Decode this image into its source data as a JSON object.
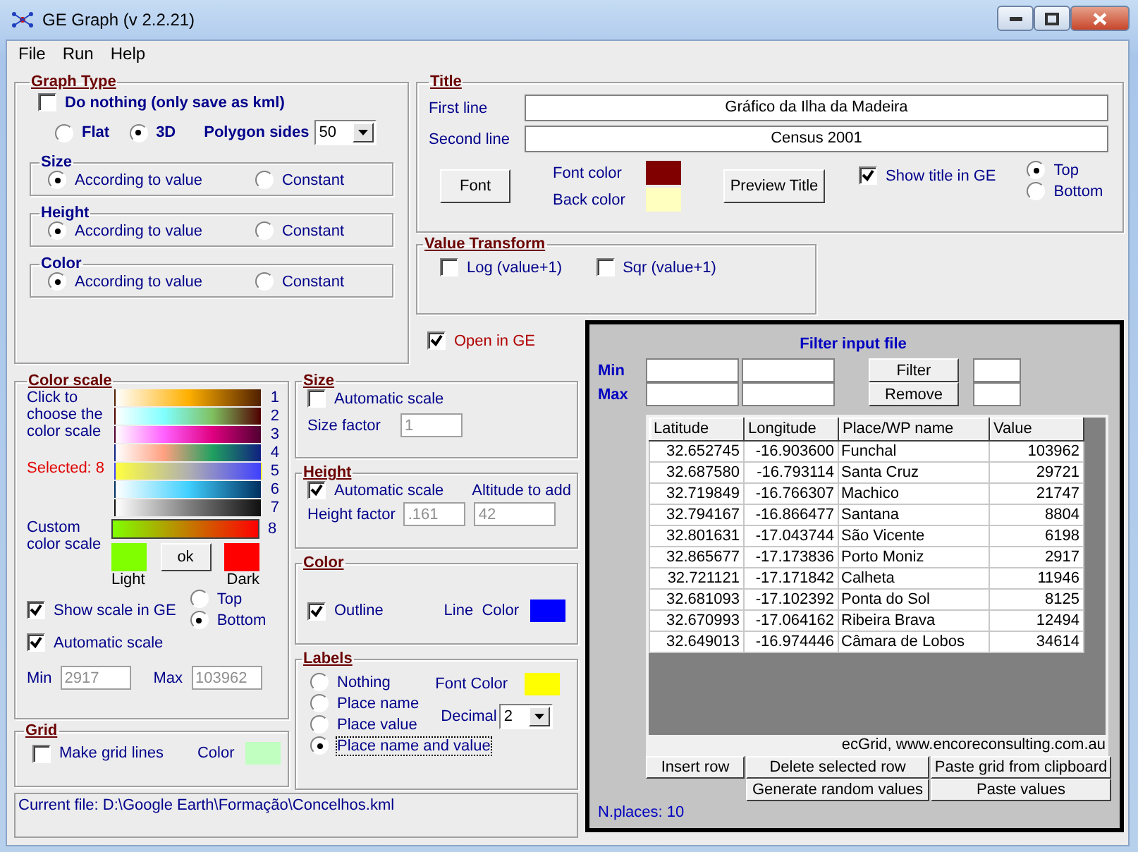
{
  "window": {
    "title": "GE Graph (v 2.2.21)"
  },
  "menu": [
    "File",
    "Run",
    "Help"
  ],
  "graph_type": {
    "title": "Graph Type",
    "do_nothing": {
      "label": "Do nothing (only save as kml)",
      "checked": false
    },
    "modes": [
      {
        "label": "Flat",
        "selected": false
      },
      {
        "label": "3D",
        "selected": true
      }
    ],
    "polygon_sides": {
      "label": "Polygon sides",
      "value": "50"
    },
    "subgroups": [
      {
        "title": "Size",
        "options": [
          {
            "label": "According to value",
            "selected": true
          },
          {
            "label": "Constant",
            "selected": false
          }
        ]
      },
      {
        "title": "Height",
        "options": [
          {
            "label": "According to value",
            "selected": true
          },
          {
            "label": "Constant",
            "selected": false
          }
        ]
      },
      {
        "title": "Color",
        "options": [
          {
            "label": "According to value",
            "selected": true
          },
          {
            "label": "Constant",
            "selected": false
          }
        ]
      }
    ]
  },
  "title_group": {
    "title": "Title",
    "lines": [
      {
        "label": "First line",
        "value": "Gráfico da Ilha da Madeira"
      },
      {
        "label": "Second line",
        "value": "Census 2001"
      }
    ],
    "font_button": "Font",
    "colors": [
      {
        "label": "Font color",
        "color": "#800000"
      },
      {
        "label": "Back color",
        "color": "#ffffc0"
      }
    ],
    "preview_button": "Preview Title",
    "show_title": {
      "label": "Show title in GE",
      "checked": true
    },
    "positions": [
      {
        "label": "Top",
        "selected": true
      },
      {
        "label": "Bottom",
        "selected": false
      }
    ]
  },
  "value_transform": {
    "title": "Value Transform",
    "options": [
      {
        "label": "Log (value+1)",
        "checked": false
      },
      {
        "label": "Sqr (value+1)",
        "checked": false
      }
    ]
  },
  "open_in_ge": {
    "label": "Open in GE",
    "checked": true
  },
  "color_scale": {
    "title": "Color scale",
    "hint": "Click to choose the color scale",
    "selected_text": "Selected: 8",
    "scales": [
      {
        "number": "1"
      },
      {
        "number": "2"
      },
      {
        "number": "3"
      },
      {
        "number": "4"
      },
      {
        "number": "5"
      },
      {
        "number": "6"
      },
      {
        "number": "7"
      }
    ],
    "custom_label": "Custom color scale",
    "custom_scale": {
      "number": "8"
    },
    "light": {
      "label": "Light",
      "color": "#80ff00"
    },
    "ok_button": "ok",
    "dark": {
      "label": "Dark",
      "color": "#ff0000"
    },
    "show_scale": {
      "label": "Show scale in GE",
      "checked": true
    },
    "positions": [
      {
        "label": "Top",
        "selected": false
      },
      {
        "label": "Bottom",
        "selected": true
      }
    ],
    "automatic_scale": {
      "label": "Automatic scale",
      "checked": true
    },
    "min": {
      "label": "Min",
      "value": "2917",
      "disabled": true
    },
    "max": {
      "label": "Max",
      "value": "103962",
      "disabled": true
    }
  },
  "grid": {
    "title": "Grid",
    "make_lines": {
      "label": "Make grid lines",
      "checked": false
    },
    "line_color": {
      "label": "Color",
      "color": "#c0ffc0"
    }
  },
  "size": {
    "title": "Size",
    "automatic_scale": {
      "label": "Automatic scale",
      "checked": false
    },
    "factor": {
      "label": "Size factor",
      "value": "1",
      "disabled": true
    }
  },
  "height": {
    "title": "Height",
    "automatic_scale": {
      "label": "Automatic scale",
      "checked": true
    },
    "altitude_label": "Altitude to add",
    "factor": {
      "label": "Height factor",
      "value": ".161",
      "disabled": true
    },
    "altitude": {
      "value": "42",
      "disabled": true
    }
  },
  "color": {
    "title": "Color",
    "outline": {
      "label": "Outline",
      "checked": true
    },
    "line_color": {
      "label": "Line  Color",
      "color": "#0000ff"
    }
  },
  "labels": {
    "title": "Labels",
    "options": [
      {
        "label": "Nothing",
        "selected": false
      },
      {
        "label": "Place name",
        "selected": false
      },
      {
        "label": "Place value",
        "selected": false
      },
      {
        "label": "Place name and value",
        "selected": true
      }
    ],
    "font_color": {
      "label": "Font Color",
      "color": "#ffff00"
    },
    "decimal": {
      "label": "Decimal",
      "value": "2"
    }
  },
  "current_file": "Current file: D:\\Google Earth\\Formação\\Concelhos.kml",
  "filter": {
    "title": "Filter input file",
    "min_label": "Min",
    "max_label": "Max",
    "filter_button": "Filter",
    "remove_button": "Remove",
    "table": {
      "columns": [
        "Latitude",
        "Longitude",
        "Place/WP name",
        "Value"
      ],
      "rows": [
        [
          "32.652745",
          "-16.903600",
          "Funchal",
          "103962"
        ],
        [
          "32.687580",
          "-16.793114",
          "Santa Cruz",
          "29721"
        ],
        [
          "32.719849",
          "-16.766307",
          "Machico",
          "21747"
        ],
        [
          "32.794167",
          "-16.866477",
          "Santana",
          "8804"
        ],
        [
          "32.801631",
          "-17.043744",
          "São Vicente",
          "6198"
        ],
        [
          "32.865677",
          "-17.173836",
          "Porto Moniz",
          "2917"
        ],
        [
          "32.721121",
          "-17.171842",
          "Calheta",
          "11946"
        ],
        [
          "32.681093",
          "-17.102392",
          "Ponta do Sol",
          "8125"
        ],
        [
          "32.670993",
          "-17.064162",
          "Ribeira Brava",
          "12494"
        ],
        [
          "32.649013",
          "-16.974446",
          "Câmara de Lobos",
          "34614"
        ]
      ]
    },
    "credit": "ecGrid,  www.encoreconsulting.com.au",
    "buttons": [
      "Insert row",
      "Delete selected row",
      "Paste grid from clipboard",
      "Generate random values",
      "Paste values"
    ],
    "count": "N.places: 10"
  }
}
